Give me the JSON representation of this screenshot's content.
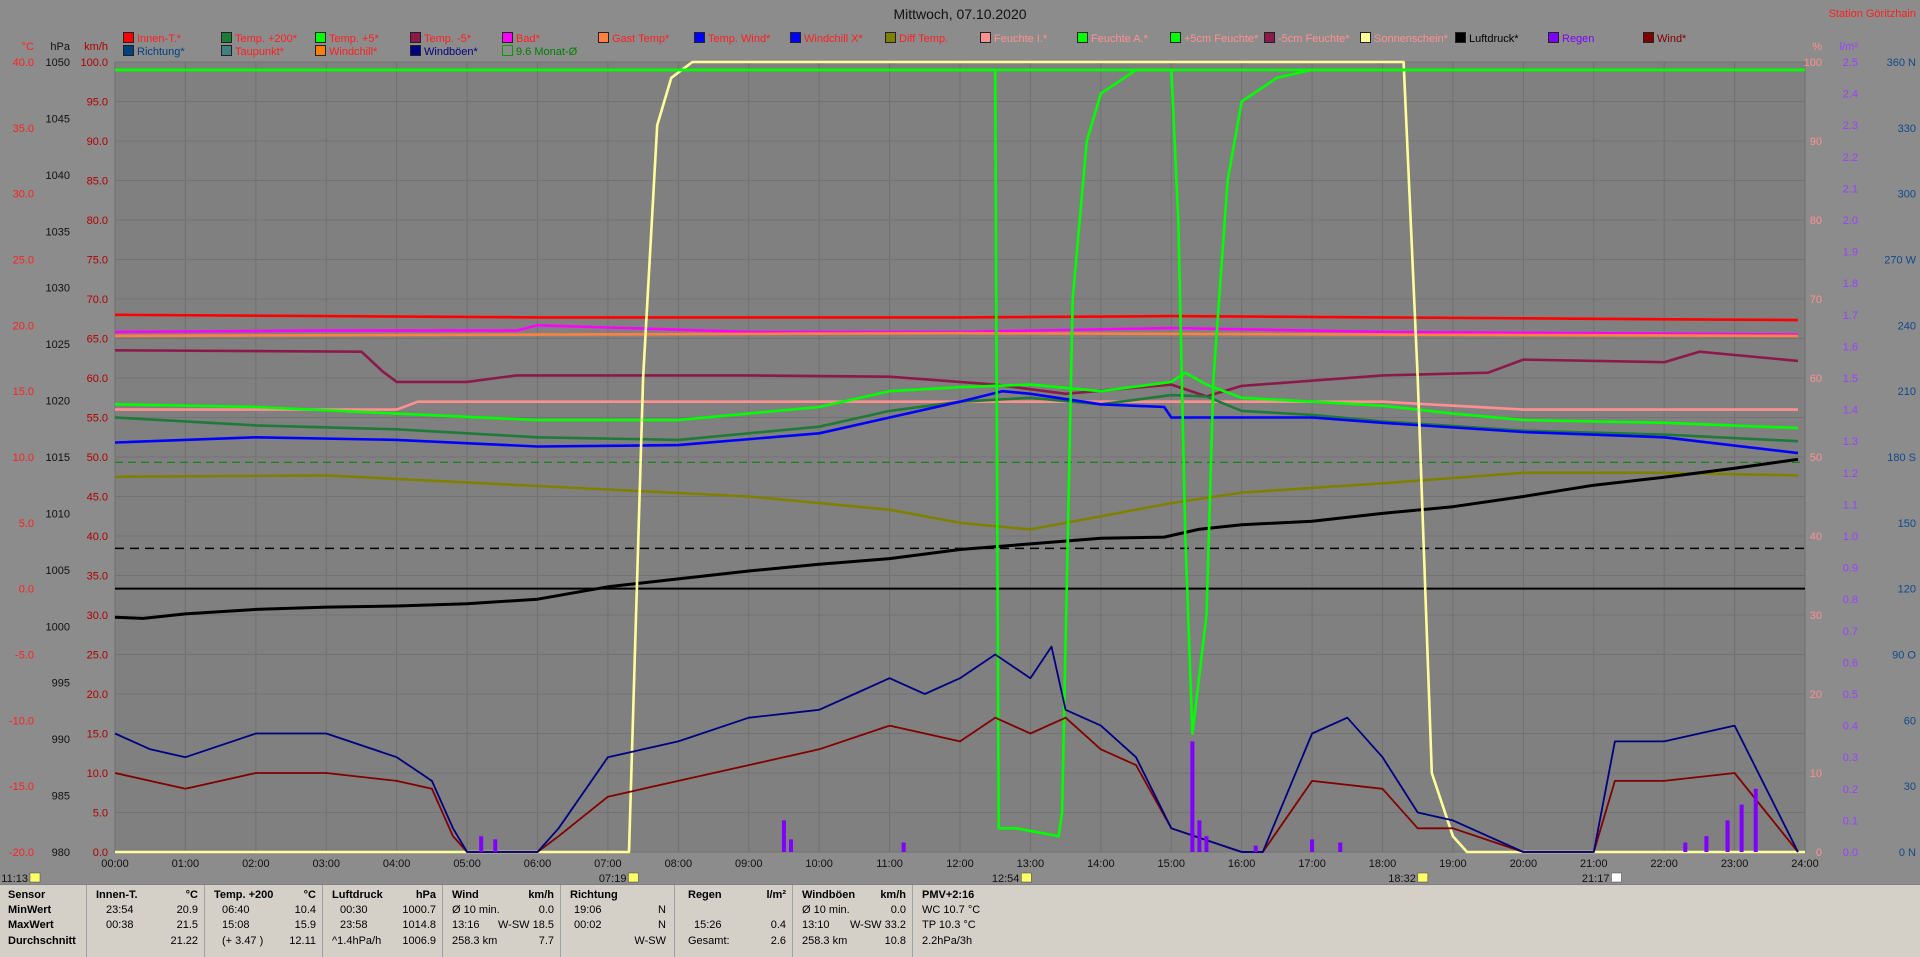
{
  "title": "Mittwoch, 07.10.2020",
  "station": "Station Göritzhain",
  "axes": {
    "celsius": {
      "unit": "°C",
      "ticks": [
        "40.0",
        "35.0",
        "30.0",
        "25.0",
        "20.0",
        "15.0",
        "10.0",
        "5.0",
        "0.0",
        "-5.0",
        "-10.0",
        "-15.0",
        "-20.0"
      ]
    },
    "hpa": {
      "unit": "hPa",
      "ticks": [
        "1050",
        "1045",
        "1040",
        "1035",
        "1030",
        "1025",
        "1020",
        "1015",
        "1010",
        "1005",
        "1000",
        "995",
        "990",
        "985",
        "980"
      ]
    },
    "kmh": {
      "unit": "km/h",
      "ticks": [
        "100.0",
        "95.0",
        "90.0",
        "85.0",
        "80.0",
        "75.0",
        "70.0",
        "65.0",
        "60.0",
        "55.0",
        "50.0",
        "45.0",
        "40.0",
        "35.0",
        "30.0",
        "25.0",
        "20.0",
        "15.0",
        "10.0",
        "5.0",
        "0.0"
      ]
    },
    "percent": {
      "unit": "%",
      "ticks": [
        "100",
        "90",
        "80",
        "70",
        "60",
        "50",
        "40",
        "30",
        "20",
        "10",
        "0"
      ]
    },
    "rain": {
      "unit": "l/m²",
      "ticks": [
        "2.5",
        "2.4",
        "2.3",
        "2.2",
        "2.1",
        "2.0",
        "1.9",
        "1.8",
        "1.7",
        "1.6",
        "1.5",
        "1.4",
        "1.3",
        "1.2",
        "1.1",
        "1.0",
        "0.9",
        "0.8",
        "0.7",
        "0.6",
        "0.5",
        "0.4",
        "0.3",
        "0.2",
        "0.1",
        "0.0"
      ]
    },
    "direction": {
      "ticks": [
        "360 N",
        "330",
        "300",
        "270 W",
        "240",
        "210",
        "180 S",
        "150",
        "120",
        "90 O",
        "60",
        "30",
        "0 N"
      ]
    },
    "time": {
      "ticks": [
        "00:00",
        "01:00",
        "02:00",
        "03:00",
        "04:00",
        "05:00",
        "06:00",
        "07:00",
        "08:00",
        "09:00",
        "10:00",
        "11:00",
        "12:00",
        "13:00",
        "14:00",
        "15:00",
        "16:00",
        "17:00",
        "18:00",
        "19:00",
        "20:00",
        "21:00",
        "22:00",
        "23:00",
        "24:00"
      ]
    }
  },
  "time_markers": [
    {
      "label": "11:13",
      "color": "#ffff66"
    },
    {
      "label": "07:19",
      "color": "#ffff66"
    },
    {
      "label": "12:54",
      "color": "#ffff66"
    },
    {
      "label": "18:32",
      "color": "#ffff66"
    },
    {
      "label": "21:17",
      "color": "#ffffff"
    }
  ],
  "legend": [
    {
      "label": "Innen-T.*",
      "color": "#ff0000",
      "text": "#ff2020"
    },
    {
      "label": "Temp. +200*",
      "color": "#1f7a3a",
      "text": "#ff2020"
    },
    {
      "label": "Temp. +5*",
      "color": "#00ff00",
      "text": "#ff2020"
    },
    {
      "label": "Temp. -5*",
      "color": "#8b1a4a",
      "text": "#ff2020"
    },
    {
      "label": "Bad*",
      "color": "#ff00ff",
      "text": "#ff2020"
    },
    {
      "label": "Gast Temp*",
      "color": "#ff8040",
      "text": "#ff2020"
    },
    {
      "label": "Temp. Wind*",
      "color": "#0000ff",
      "text": "#ff2020"
    },
    {
      "label": "Windchill X*",
      "color": "#0000ff",
      "text": "#ff2020"
    },
    {
      "label": "Diff Temp.",
      "color": "#808000",
      "text": "#ff2020"
    },
    {
      "label": "Feuchte I.*",
      "color": "#ff9090",
      "text": "#ff9090"
    },
    {
      "label": "Feuchte A.*",
      "color": "#00ff00",
      "text": "#ff9090"
    },
    {
      "label": "+5cm Feuchte*",
      "color": "#00ff00",
      "text": "#ff9090"
    },
    {
      "label": "-5cm Feuchte*",
      "color": "#8b1a4a",
      "text": "#ff9090"
    },
    {
      "label": "Sonnenschein*",
      "color": "#ffff99",
      "text": "#ff9090"
    },
    {
      "label": "Luftdruck*",
      "color": "#000000",
      "text": "#000000"
    },
    {
      "label": "Regen",
      "color": "#8000ff",
      "text": "#8000ff"
    },
    {
      "label": "Wind*",
      "color": "#800000",
      "text": "#800000"
    },
    {
      "label": "Richtung*",
      "color": "#004080",
      "text": "#004080"
    },
    {
      "label": "Taupunkt*",
      "color": "#408080",
      "text": "#ff2020"
    },
    {
      "label": "Windchill*",
      "color": "#ff8000",
      "text": "#ff2020"
    },
    {
      "label": "Windböen*",
      "color": "#000080",
      "text": "#000080"
    },
    {
      "label": "9.6 Monat-Ø",
      "color": "#00a000",
      "text": "#008000",
      "outline": true
    }
  ],
  "chart_data": {
    "type": "line",
    "title": "Mittwoch, 07.10.2020",
    "x_unit": "hour of day",
    "xlim": [
      0,
      24
    ],
    "series": [
      {
        "name": "Innen-T.*",
        "unit": "°C",
        "color": "#ff0000",
        "x": [
          0,
          3,
          6,
          9,
          12,
          15,
          18,
          21,
          23.9
        ],
        "y": [
          20.8,
          20.7,
          20.6,
          20.6,
          20.6,
          20.7,
          20.6,
          20.5,
          20.4
        ]
      },
      {
        "name": "Bad*",
        "unit": "°C",
        "color": "#ff00ff",
        "x": [
          0,
          3,
          5.7,
          6,
          9,
          12,
          15,
          18,
          21,
          23.9
        ],
        "y": [
          19.5,
          19.6,
          19.6,
          20.0,
          19.5,
          19.5,
          19.8,
          19.5,
          19.4,
          19.3
        ]
      },
      {
        "name": "Gast Temp*",
        "unit": "°C",
        "color": "#ff8040",
        "x": [
          0,
          6,
          12,
          18,
          23.9
        ],
        "y": [
          19.2,
          19.3,
          19.4,
          19.3,
          19.2
        ]
      },
      {
        "name": "Feuchte I.*",
        "unit": "%",
        "color": "#ff9090",
        "x": [
          0,
          4,
          4.3,
          6,
          9,
          12,
          15,
          18,
          20,
          23.9
        ],
        "y": [
          56,
          56,
          57,
          57,
          57,
          57,
          57,
          57,
          56,
          56
        ]
      },
      {
        "name": "Temp. -5*",
        "unit": "°C",
        "color": "#8b1a4a",
        "x": [
          0,
          3.5,
          3.8,
          4,
          5,
          5.7,
          6,
          9,
          11,
          12.5,
          13.5,
          15,
          15.5,
          16,
          18,
          19.5,
          20,
          22,
          22.5,
          23.9
        ],
        "y": [
          18.1,
          18.0,
          16.5,
          15.7,
          15.7,
          16.2,
          16.2,
          16.2,
          16.1,
          15.5,
          14.8,
          15.5,
          14.6,
          15.4,
          16.2,
          16.4,
          17.4,
          17.2,
          18.0,
          17.3
        ]
      },
      {
        "name": "Temp. +200*",
        "unit": "°C",
        "color": "#1f7a3a",
        "x": [
          0,
          2,
          4,
          6,
          8,
          10,
          11,
          12,
          13,
          14,
          15,
          15.5,
          16,
          17,
          18,
          20,
          22,
          23.9
        ],
        "y": [
          13.0,
          12.4,
          12.1,
          11.5,
          11.3,
          12.3,
          13.5,
          14.2,
          14.5,
          14.0,
          14.7,
          14.6,
          13.5,
          13.2,
          12.7,
          12.0,
          11.7,
          11.2
        ]
      },
      {
        "name": "Temp. +5*",
        "unit": "°C",
        "color": "#00ff00",
        "x": [
          0,
          2,
          4,
          6,
          8,
          10,
          11,
          12,
          13,
          14,
          15,
          15.2,
          15.5,
          16,
          17,
          18,
          19,
          20,
          22,
          23.9
        ],
        "y": [
          14.0,
          13.8,
          13.3,
          12.8,
          12.8,
          13.8,
          15.0,
          15.3,
          15.5,
          15.0,
          15.7,
          16.4,
          15.5,
          14.5,
          14.2,
          13.9,
          13.3,
          12.8,
          12.6,
          12.2
        ]
      },
      {
        "name": "Temp. Wind*",
        "unit": "°C",
        "color": "#0000ff",
        "x": [
          0,
          2,
          4,
          6,
          8,
          10,
          11,
          12,
          12.6,
          13,
          14,
          14.9,
          15,
          15.3,
          16,
          17,
          18,
          20,
          22,
          23.9
        ],
        "y": [
          11.1,
          11.5,
          11.3,
          10.8,
          10.9,
          11.8,
          13.0,
          14.2,
          15.0,
          14.8,
          14.0,
          13.8,
          13.0,
          13.0,
          13.0,
          13.0,
          12.6,
          11.9,
          11.5,
          10.3
        ]
      },
      {
        "name": "Diff Temp.",
        "unit": "°C",
        "color": "#808000",
        "x": [
          0,
          3,
          6,
          9,
          11,
          12,
          13,
          14,
          15,
          16,
          18,
          20,
          22,
          23.9
        ],
        "y": [
          8.5,
          8.6,
          7.8,
          7.0,
          6.0,
          5.0,
          4.5,
          5.5,
          6.5,
          7.3,
          8.0,
          8.8,
          8.8,
          8.6
        ]
      },
      {
        "name": "Luftdruck*",
        "unit": "hPa",
        "x": [
          0,
          0.4,
          1,
          2,
          3,
          4,
          5,
          6,
          7,
          8,
          9,
          10,
          11,
          12,
          13,
          14,
          14.9,
          15.4,
          16,
          17,
          18,
          19,
          20,
          21,
          22,
          23,
          23.9
        ],
        "y": [
          1000.8,
          1000.7,
          1001.1,
          1001.5,
          1001.7,
          1001.8,
          1002.0,
          1002.4,
          1003.5,
          1004.2,
          1004.9,
          1005.5,
          1006.0,
          1006.8,
          1007.3,
          1007.8,
          1007.9,
          1008.6,
          1009.0,
          1009.3,
          1010.0,
          1010.6,
          1011.5,
          1012.5,
          1013.2,
          1014.0,
          1014.8
        ]
      },
      {
        "name": "Sonnenschein*",
        "unit": "%",
        "color": "#ffff99",
        "x": [
          0,
          7.3,
          7.5,
          7.7,
          7.9,
          8.2,
          10,
          12,
          14,
          16,
          18,
          18.3,
          18.5,
          18.7,
          19,
          19.2,
          24
        ],
        "y": [
          0,
          0,
          60,
          92,
          98,
          100,
          100,
          100,
          100,
          100,
          100,
          100,
          60,
          10,
          2,
          0,
          0
        ]
      },
      {
        "name": "Feuchte A.*",
        "unit": "%",
        "color": "#00ff00",
        "x": [
          0,
          12.5,
          12.55,
          12.8,
          13.4,
          13.45,
          13.6,
          13.8,
          14,
          14.5,
          15,
          15.05,
          24
        ],
        "y": [
          99,
          99,
          3,
          3,
          2,
          5,
          70,
          90,
          96,
          99,
          99,
          99,
          99
        ]
      },
      {
        "name": "+5cm Feuchte*",
        "unit": "%",
        "color": "#00ff00",
        "x": [
          0,
          15,
          15.1,
          15.2,
          15.3,
          15.5,
          15.6,
          15.8,
          16,
          16.5,
          17,
          24
        ],
        "y": [
          99,
          99,
          80,
          40,
          15,
          30,
          60,
          85,
          95,
          98,
          99,
          99
        ]
      },
      {
        "name": "Wind*",
        "unit": "km/h",
        "color": "#800000",
        "x": [
          0,
          0.5,
          1,
          2,
          3,
          4,
          4.5,
          4.8,
          5,
          6,
          6.3,
          7,
          7.5,
          8,
          9,
          10,
          11,
          12,
          12.5,
          13,
          13.5,
          14,
          14.5,
          15,
          16,
          16.3,
          17,
          18,
          18.5,
          19,
          20,
          21,
          21.3,
          22,
          23,
          23.9
        ],
        "y": [
          10,
          9,
          8,
          10,
          10,
          9,
          8,
          2,
          0,
          0,
          2,
          7,
          8,
          9,
          11,
          13,
          16,
          14,
          17,
          15,
          17,
          13,
          11,
          3,
          0,
          0,
          9,
          8,
          3,
          3,
          0,
          0,
          9,
          9,
          10,
          0
        ]
      },
      {
        "name": "Windböen*",
        "unit": "km/h",
        "color": "#000080",
        "x": [
          0,
          0.5,
          1,
          2,
          3,
          4,
          4.5,
          4.8,
          5,
          6,
          6.3,
          7,
          7.5,
          8,
          9,
          10,
          10.5,
          11,
          11.5,
          12,
          12.5,
          13,
          13.3,
          13.5,
          14,
          14.5,
          15,
          16,
          16.3,
          17,
          17.5,
          18,
          18.5,
          19,
          20,
          21,
          21.3,
          22,
          23,
          23.9
        ],
        "y": [
          15,
          13,
          12,
          15,
          15,
          12,
          9,
          3,
          0,
          0,
          3,
          12,
          13,
          14,
          17,
          18,
          20,
          22,
          20,
          22,
          25,
          22,
          26,
          18,
          16,
          12,
          3,
          0,
          0,
          15,
          17,
          12,
          5,
          4,
          0,
          0,
          14,
          14,
          16,
          0
        ]
      },
      {
        "name": "Regen",
        "unit": "l/m²",
        "color": "#8000ff",
        "x": [
          5.2,
          5.4,
          9.5,
          9.6,
          11.2,
          15.3,
          15.4,
          15.5,
          16.2,
          17.0,
          17.4,
          22.3,
          22.6,
          22.9,
          23.1,
          23.3
        ],
        "y": [
          0.05,
          0.04,
          0.1,
          0.04,
          0.03,
          0.35,
          0.1,
          0.05,
          0.02,
          0.04,
          0.03,
          0.03,
          0.05,
          0.1,
          0.15,
          0.2
        ]
      }
    ]
  },
  "stats": {
    "sensor": {
      "header": "Sensor",
      "rows": [
        "MinWert",
        "MaxWert",
        "Durchschnitt"
      ]
    },
    "innen": {
      "header": "Innen-T.",
      "unit": "°C",
      "rows": [
        [
          "23:54",
          "20.9"
        ],
        [
          "00:38",
          "21.5"
        ],
        [
          "",
          "21.22"
        ]
      ]
    },
    "temp200": {
      "header": "Temp. +200",
      "unit": "°C",
      "rows": [
        [
          "06:40",
          "10.4"
        ],
        [
          "15:08",
          "15.9"
        ],
        [
          "(+ 3.47 )",
          "12.11"
        ]
      ]
    },
    "luftdruck": {
      "header": "Luftdruck",
      "unit": "hPa",
      "rows": [
        [
          "00:30",
          "1000.7"
        ],
        [
          "23:58",
          "1014.8"
        ],
        [
          "^1.4hPa/h",
          "1006.9"
        ]
      ]
    },
    "wind": {
      "header": "Wind",
      "unit": "km/h",
      "rows": [
        [
          "Ø 10 min.",
          "",
          "0.0"
        ],
        [
          "13:16",
          "W-SW 18.5",
          ""
        ],
        [
          "258.3 km",
          "",
          "7.7"
        ]
      ]
    },
    "richtung": {
      "header": "Richtung",
      "rows": [
        [
          "19:06",
          "N"
        ],
        [
          "00:02",
          "N"
        ],
        [
          "",
          "W-SW"
        ]
      ]
    },
    "regen": {
      "header": "Regen",
      "unit": "l/m²",
      "rows": [
        [
          "",
          ""
        ],
        [
          "15:26",
          "0.4"
        ],
        [
          "Gesamt:",
          "2.6"
        ]
      ]
    },
    "windboeen": {
      "header": "Windböen",
      "unit": "km/h",
      "rows": [
        [
          "Ø 10 min.",
          "",
          "0.0"
        ],
        [
          "13:10",
          "W-SW 33.2",
          ""
        ],
        [
          "258.3 km",
          "",
          "10.8"
        ]
      ]
    },
    "pmv": {
      "header": "PMV+2:16",
      "rows": [
        "WC 10.7 °C",
        "TP 10.3 °C",
        "2.2hPa/3h"
      ]
    }
  }
}
